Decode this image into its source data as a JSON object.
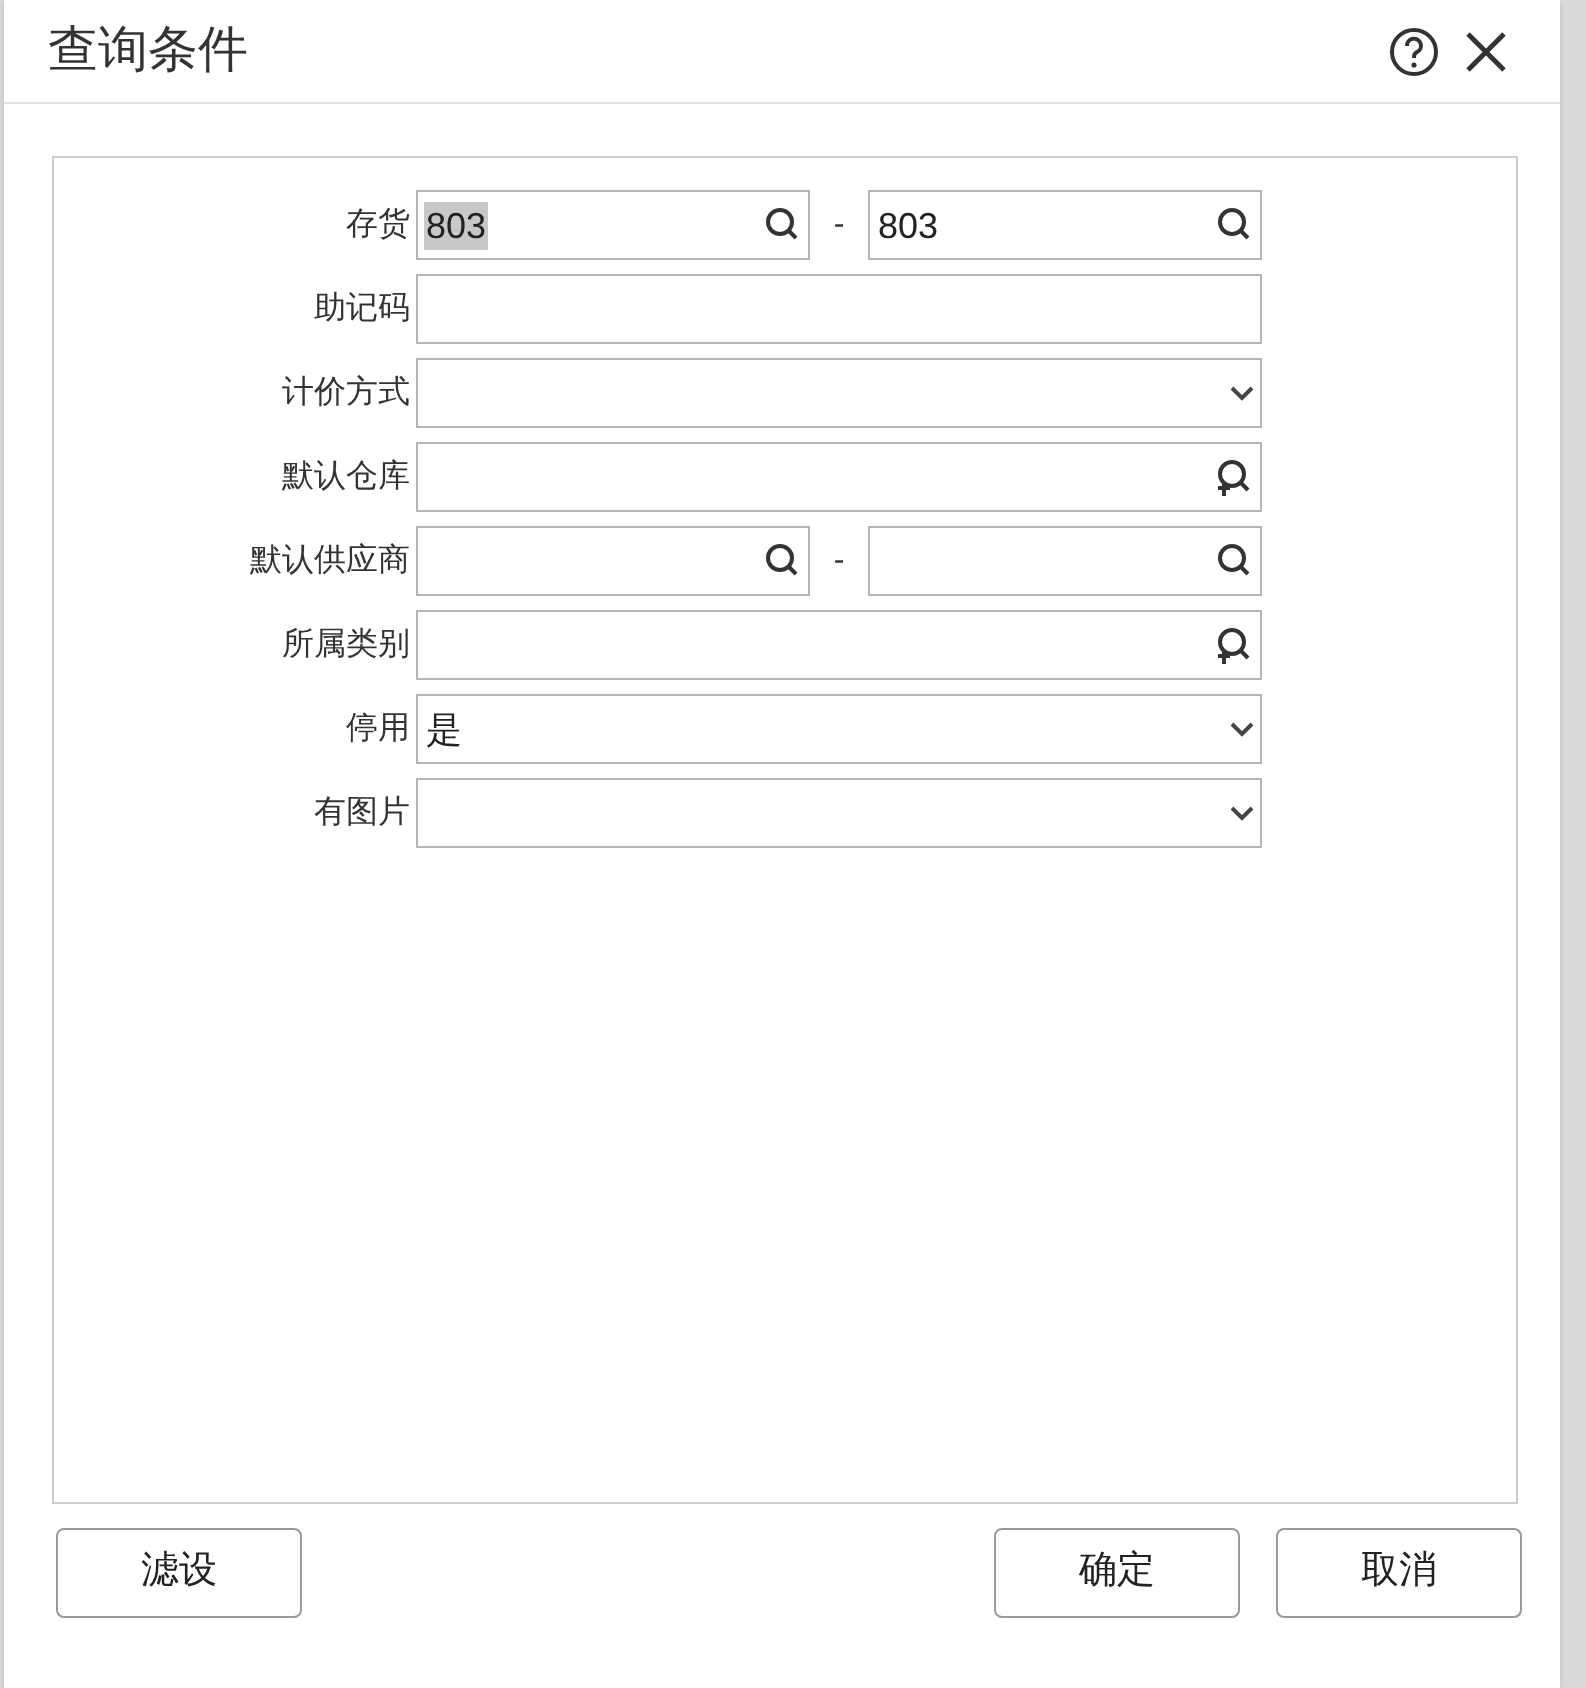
{
  "window": {
    "title": "查询条件"
  },
  "fields": [
    {
      "kind": "range",
      "label": "存货",
      "from": {
        "value": "803",
        "highlighted": true
      },
      "to": {
        "value": "803",
        "highlighted": false
      }
    },
    {
      "kind": "text",
      "label": "助记码"
    },
    {
      "kind": "select",
      "label": "计价方式"
    },
    {
      "kind": "lookup",
      "label": "默认仓库"
    },
    {
      "kind": "range",
      "label": "默认供应商"
    },
    {
      "kind": "lookup",
      "label": "所属类别"
    },
    {
      "kind": "select",
      "label": "停用",
      "value": "是"
    },
    {
      "kind": "select",
      "label": "有图片"
    }
  ],
  "range_separator": "-",
  "buttons": {
    "left": [
      "滤设"
    ],
    "right": [
      "确定",
      "取消"
    ]
  }
}
